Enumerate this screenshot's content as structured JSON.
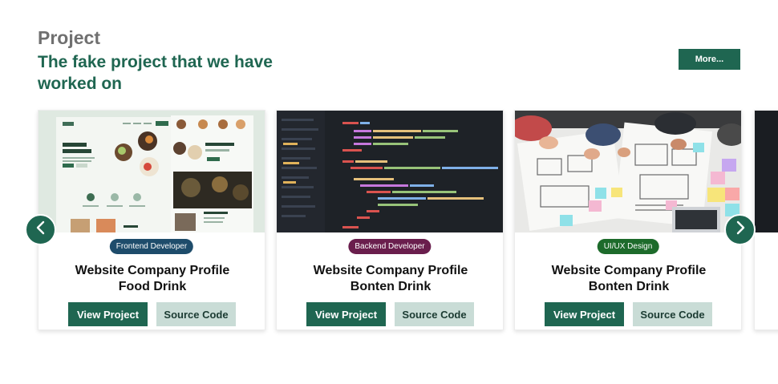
{
  "header": {
    "eyebrow": "Project",
    "headline": "The fake project that we have worked on",
    "more_label": "More..."
  },
  "projects": [
    {
      "category": "Frontend Developer",
      "category_color": "#1e4c6b",
      "title_line1": "Website Company Profile",
      "title_line2": "Food Drink",
      "view_label": "View Project",
      "source_label": "Source Code",
      "thumbnail_icon": "food-website-mockup"
    },
    {
      "category": "Backend Developer",
      "category_color": "#6a1e4d",
      "title_line1": "Website Company Profile",
      "title_line2": "Bonten Drink",
      "view_label": "View Project",
      "source_label": "Source Code",
      "thumbnail_icon": "code-editor-screenshot"
    },
    {
      "category": "UI/UX Design",
      "category_color": "#1d6b2b",
      "title_line1": "Website Company Profile",
      "title_line2": "Bonten Drink",
      "view_label": "View Project",
      "source_label": "Source Code",
      "thumbnail_icon": "wireframe-sketch-photo"
    }
  ],
  "carousel": {
    "prev_icon": "chevron-left-icon",
    "next_icon": "chevron-right-icon"
  },
  "colors": {
    "primary": "#1f6651",
    "secondary": "#c9dcd6",
    "muted_heading": "#707070"
  }
}
